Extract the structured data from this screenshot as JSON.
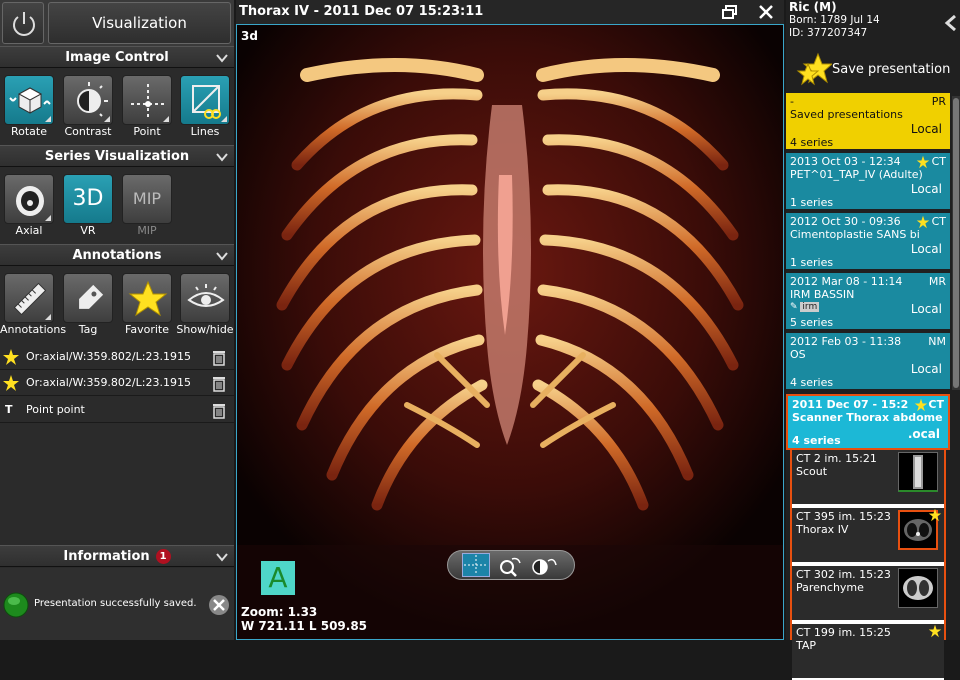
{
  "header": {
    "visualization_label": "Visualization"
  },
  "sections": {
    "image_control": "Image Control",
    "series_visualization": "Series Visualization",
    "annotations": "Annotations",
    "information": "Information"
  },
  "image_control_tools": [
    {
      "label": "Rotate",
      "icon": "rotate-icon"
    },
    {
      "label": "Contrast",
      "icon": "contrast-icon"
    },
    {
      "label": "Point",
      "icon": "point-icon"
    },
    {
      "label": "Lines",
      "icon": "lines-icon"
    }
  ],
  "series_tools": [
    {
      "label": "Axial",
      "icon": "axial-icon"
    },
    {
      "label": "VR",
      "icon_text": "3D"
    },
    {
      "label": "MIP",
      "icon_text": "MIP"
    }
  ],
  "annotation_tools": [
    {
      "label": "Annotations",
      "icon": "ruler-icon"
    },
    {
      "label": "Tag",
      "icon": "tag-icon"
    },
    {
      "label": "Favorite",
      "icon": "star-icon"
    },
    {
      "label": "Show/hide",
      "icon": "eye-icon"
    }
  ],
  "annotation_list": [
    {
      "text": "Or:axial/W:359.802/L:23.1915",
      "icon": "star-icon"
    },
    {
      "text": "Or:axial/W:359.802/L:23.1915",
      "icon": "star-icon"
    },
    {
      "text": "Point point",
      "icon": "text-icon",
      "prefix": "T"
    }
  ],
  "information": {
    "badge_count": "1",
    "message": "Presentation successfully saved."
  },
  "viewer": {
    "title": "Thorax   IV - 2011 Dec 07 15:23:11",
    "mode_label": "3d",
    "orientation": "A",
    "zoom": "Zoom: 1.33",
    "window_level": "W 721.11 L 509.85"
  },
  "patient": {
    "name": "Ric (M)",
    "born": "Born: 1789 Jul 14",
    "id": "ID: 377207347"
  },
  "save_presentation_label": "Save presentation",
  "studies": [
    {
      "date": "-",
      "mod": "PR",
      "desc": "Saved presentations",
      "count": "4 series",
      "loc": "Local",
      "style": "yellow"
    },
    {
      "date": "2013 Oct 03 - 12:34",
      "mod": "CT",
      "desc": "PET^01_TAP_IV (Adulte)",
      "count": "1 series",
      "loc": "Local",
      "style": "teal",
      "star": true
    },
    {
      "date": "2012 Oct 30 - 09:36",
      "mod": "CT",
      "desc": "Cimentoplastie SANS bi",
      "count": "1 series",
      "loc": "Local",
      "style": "teal",
      "star": true
    },
    {
      "date": "2012 Mar 08 - 11:14",
      "mod": "MR",
      "desc": "IRM BASSIN",
      "tag": "irm",
      "count": "5 series",
      "loc": "Local",
      "style": "teal"
    },
    {
      "date": "2012 Feb 03 - 11:38",
      "mod": "NM",
      "desc": "OS",
      "count": "4 series",
      "loc": "Local",
      "style": "teal"
    },
    {
      "date": "2011 Dec 07 - 15:2",
      "mod": "CT",
      "desc": "Scanner Thorax abdome",
      "count": "4 series",
      "loc": ".ocal",
      "style": "sel",
      "star": true
    }
  ],
  "series": [
    {
      "line1": "CT 2 im. 15:21",
      "line2": "Scout"
    },
    {
      "line1": "CT 395 im. 15:23",
      "line2": "Thorax   IV",
      "star": true
    },
    {
      "line1": "CT 302 im. 15:23",
      "line2": "Parenchyme"
    },
    {
      "line1": "CT 199 im. 15:25",
      "line2": "TAP",
      "star": true
    }
  ],
  "colors": {
    "accent_teal": "#1a8aa0",
    "selected_border": "#e85010",
    "saved_yellow": "#f0d000",
    "star_yellow": "#ffe020"
  }
}
